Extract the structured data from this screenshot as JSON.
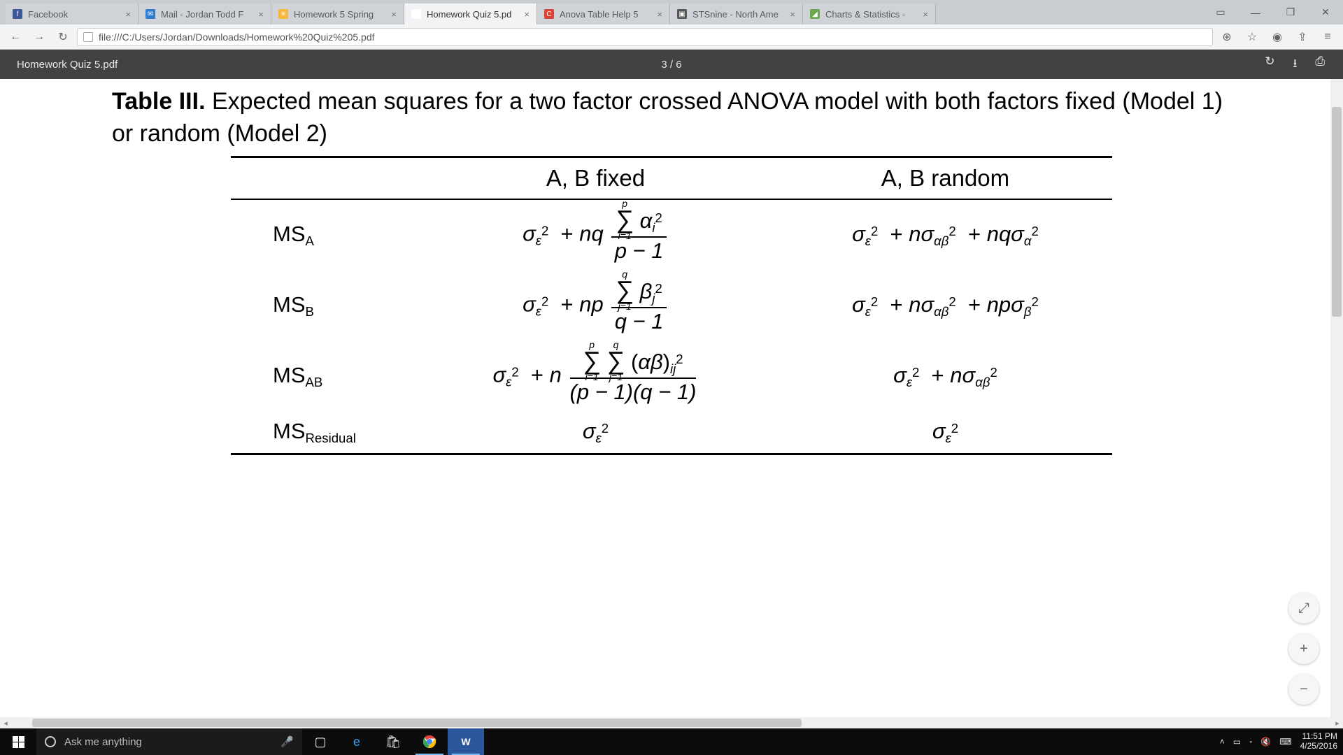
{
  "tabs": [
    {
      "label": "Facebook",
      "favbg": "#3b5998",
      "favtxt": "f"
    },
    {
      "label": "Mail - Jordan Todd F",
      "favbg": "#2f7dd1",
      "favtxt": "✉"
    },
    {
      "label": "Homework 5 Spring",
      "favbg": "#f6b73c",
      "favtxt": "✳"
    },
    {
      "label": "Homework Quiz 5.pd",
      "favbg": "#ffffff",
      "favtxt": ""
    },
    {
      "label": "Anova Table Help 5",
      "favbg": "#db4437",
      "favtxt": "C"
    },
    {
      "label": "STSnine - North Ame",
      "favbg": "#555",
      "favtxt": "▣"
    },
    {
      "label": "Charts & Statistics -",
      "favbg": "#6aa84f",
      "favtxt": "◢"
    }
  ],
  "active_tab_index": 3,
  "win": {
    "min": "—",
    "max": "❐",
    "close": "✕",
    "user": "▭"
  },
  "nav": {
    "back": "←",
    "fwd": "→",
    "reload": "↻"
  },
  "url": "file:///C:/Users/Jordan/Downloads/Homework%20Quiz%205.pdf",
  "addr_right": {
    "zoom": "⊕",
    "star": "☆",
    "cast": "◉",
    "ext": "⇪",
    "menu": "≡"
  },
  "pdf": {
    "filename": "Homework Quiz 5.pdf",
    "page": "3 / 6",
    "tools": {
      "rotate": "↻",
      "download": "⭳",
      "print": "⎙"
    }
  },
  "fab": {
    "fit": "⤢",
    "plus": "+",
    "minus": "−"
  },
  "doc": {
    "title_bold": "Table III.",
    "title_rest": " Expected mean squares for a two factor crossed ANOVA model with both factors fixed (Model 1) or random (Model 2)",
    "col1": "A, B fixed",
    "col2": "A, B random",
    "rows": {
      "a": {
        "lbl": "MS",
        "sub": "A"
      },
      "b": {
        "lbl": "MS",
        "sub": "B"
      },
      "ab": {
        "lbl": "MS",
        "sub": "AB"
      },
      "res": {
        "lbl": "MS",
        "sub": "Residual"
      }
    },
    "sym": {
      "sigeps2": "σ",
      "eps": "ε",
      "sq": "2",
      "nq": "nq",
      "np": "np",
      "n": "n",
      "no": "nσ",
      "nqo": "nqσ",
      "npo": "npσ",
      "alpha": "α",
      "beta": "β",
      "ab": "αβ",
      "p": "p",
      "q": "q",
      "pm1": "p − 1",
      "qm1": "q − 1",
      "pq1": "(p − 1)(q − 1)",
      "i1": "i=1",
      "j1": "j=1"
    }
  },
  "search_placeholder": "Ask me anything",
  "tray": {
    "up": "˄",
    "batt": "▭",
    "wifi": "◦",
    "vol": "🔇",
    "kbd": "⌨",
    "time": "11:51 PM",
    "date": "4/25/2016"
  },
  "tb": {
    "taskview": "▢",
    "edge": "e",
    "store": "🛍",
    "chrome": "◎",
    "word": "W"
  }
}
